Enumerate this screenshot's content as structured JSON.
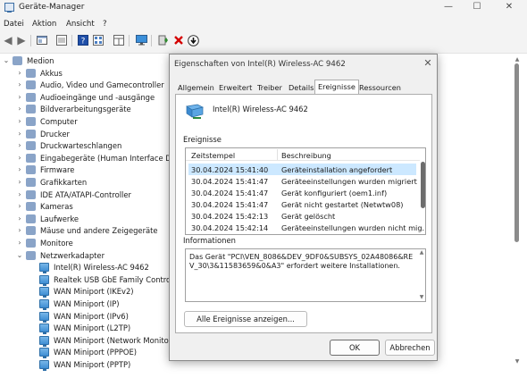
{
  "window": {
    "title": "Geräte-Manager",
    "controls": {
      "minimize": "—",
      "maximize": "☐",
      "close": "✕"
    }
  },
  "menu": [
    "Datei",
    "Aktion",
    "Ansicht",
    "?"
  ],
  "toolbar": {
    "icons": [
      "back-icon",
      "forward-icon",
      "properties-icon",
      "view-icon",
      "help-icon",
      "view-list-icon",
      "monitor-icon",
      "update-driver-icon",
      "uninstall-icon",
      "download-icon"
    ]
  },
  "tree": {
    "root": "Medion",
    "items": [
      {
        "label": "Akkus",
        "expanded": false
      },
      {
        "label": "Audio, Video und Gamecontroller",
        "expanded": false
      },
      {
        "label": "Audioeingänge und -ausgänge",
        "expanded": false
      },
      {
        "label": "Bildverarbeitungsgeräte",
        "expanded": false
      },
      {
        "label": "Computer",
        "expanded": false
      },
      {
        "label": "Drucker",
        "expanded": false
      },
      {
        "label": "Druckwarteschlangen",
        "expanded": false
      },
      {
        "label": "Eingabegeräte (Human Interface Dev",
        "expanded": false
      },
      {
        "label": "Firmware",
        "expanded": false
      },
      {
        "label": "Grafikkarten",
        "expanded": false
      },
      {
        "label": "IDE ATA/ATAPI-Controller",
        "expanded": false
      },
      {
        "label": "Kameras",
        "expanded": false
      },
      {
        "label": "Laufwerke",
        "expanded": false
      },
      {
        "label": "Mäuse und andere Zeigegeräte",
        "expanded": false
      },
      {
        "label": "Monitore",
        "expanded": false
      },
      {
        "label": "Netzwerkadapter",
        "expanded": true
      }
    ],
    "network_children": [
      "Intel(R) Wireless-AC 9462",
      "Realtek USB GbE Family Controlle",
      "WAN Miniport (IKEv2)",
      "WAN Miniport (IP)",
      "WAN Miniport (IPv6)",
      "WAN Miniport (L2TP)",
      "WAN Miniport (Network Monitor",
      "WAN Miniport (PPPOE)",
      "WAN Miniport (PPTP)"
    ]
  },
  "dialog": {
    "title": "Eigenschaften von Intel(R) Wireless-AC 9462",
    "close": "✕",
    "tabs": [
      "Allgemein",
      "Erweitert",
      "Treiber",
      "Details",
      "Ereignisse",
      "Ressourcen"
    ],
    "active_tab": "Ereignisse",
    "device_name": "Intel(R) Wireless-AC 9462",
    "events_label": "Ereignisse",
    "columns": [
      "Zeitstempel",
      "Beschreibung"
    ],
    "events": [
      {
        "time": "30.04.2024 15:41:40",
        "desc": "Geräteinstallation angefordert",
        "selected": true
      },
      {
        "time": "30.04.2024 15:41:47",
        "desc": "Geräteeinstellungen wurden migriert",
        "selected": false
      },
      {
        "time": "30.04.2024 15:41:47",
        "desc": "Gerät konfiguriert (oem1.inf)",
        "selected": false
      },
      {
        "time": "30.04.2024 15:41:47",
        "desc": "Gerät nicht gestartet (Netwtw08)",
        "selected": false
      },
      {
        "time": "30.04.2024 15:42:13",
        "desc": "Gerät gelöscht",
        "selected": false
      },
      {
        "time": "30.04.2024 15:42:14",
        "desc": "Geräteeinstellungen wurden nicht mig...",
        "selected": false
      }
    ],
    "info_label": "Informationen",
    "info_text": "Das Gerät \"PCI\\VEN_8086&DEV_9DF0&SUBSYS_02A48086&REV_30\\3&11583659&0&A3\" erfordert weitere Installationen.",
    "show_all_button": "Alle Ereignisse anzeigen...",
    "ok_button": "OK",
    "cancel_button": "Abbrechen"
  },
  "colors": {
    "selection": "#cce8ff",
    "accent": "#0067c0",
    "uninstall_red": "#d40000",
    "update_green": "#2e8b2e"
  }
}
